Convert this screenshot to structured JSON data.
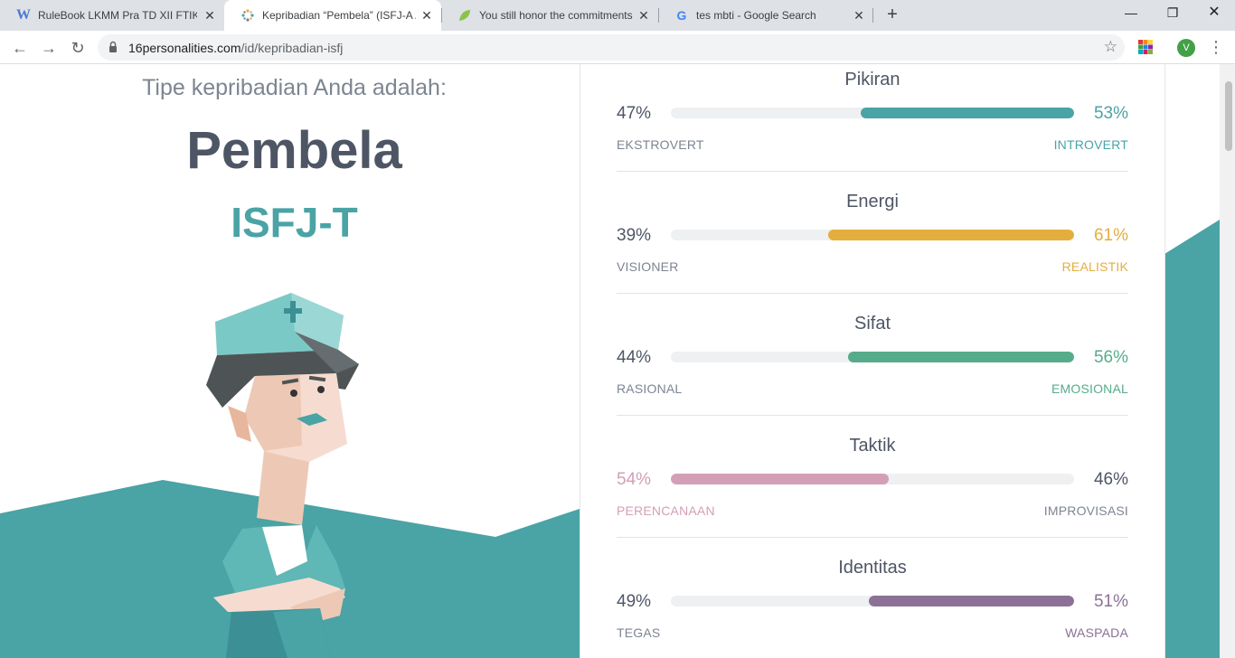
{
  "browser": {
    "tabs": [
      {
        "title": "RuleBook LKMM Pra TD XII FTIK.c",
        "favicon": "word-icon",
        "active": false
      },
      {
        "title": "Kepribadian “Pembela” (ISFJ-A / I",
        "favicon": "16personalities-icon",
        "active": true
      },
      {
        "title": "You still honor the commitments",
        "favicon": "leaf-icon",
        "active": false
      },
      {
        "title": "tes mbti - Google Search",
        "favicon": "google-icon",
        "active": false
      }
    ],
    "url_domain": "16personalities.com",
    "url_path": "/id/kepribadian-isfj",
    "profile_initial": "V"
  },
  "result": {
    "subtitle": "Tipe kepribadian Anda adalah:",
    "type_name": "Pembela",
    "type_code": "ISFJ-T"
  },
  "traits": [
    {
      "title": "Pikiran",
      "left_pct": "47%",
      "right_pct": "53%",
      "left_label": "EKSTROVERT",
      "right_label": "INTROVERT",
      "dominant": "right",
      "value": 53,
      "color": "#4aa3a5"
    },
    {
      "title": "Energi",
      "left_pct": "39%",
      "right_pct": "61%",
      "left_label": "VISIONER",
      "right_label": "REALISTIK",
      "dominant": "right",
      "value": 61,
      "color": "#e4ae3e"
    },
    {
      "title": "Sifat",
      "left_pct": "44%",
      "right_pct": "56%",
      "left_label": "RASIONAL",
      "right_label": "EMOSIONAL",
      "dominant": "right",
      "value": 56,
      "color": "#56ac8a"
    },
    {
      "title": "Taktik",
      "left_pct": "54%",
      "right_pct": "46%",
      "left_label": "PERENCANAAN",
      "right_label": "IMPROVISASI",
      "dominant": "left",
      "value": 54,
      "color": "#d39fb7"
    },
    {
      "title": "Identitas",
      "left_pct": "49%",
      "right_pct": "51%",
      "left_label": "TEGAS",
      "right_label": "WASPADA",
      "dominant": "right",
      "value": 51,
      "color": "#8c7197"
    }
  ],
  "colors": {
    "accent_teal": "#4aa3a5",
    "heading": "#4e5665",
    "muted": "#7d8591"
  }
}
